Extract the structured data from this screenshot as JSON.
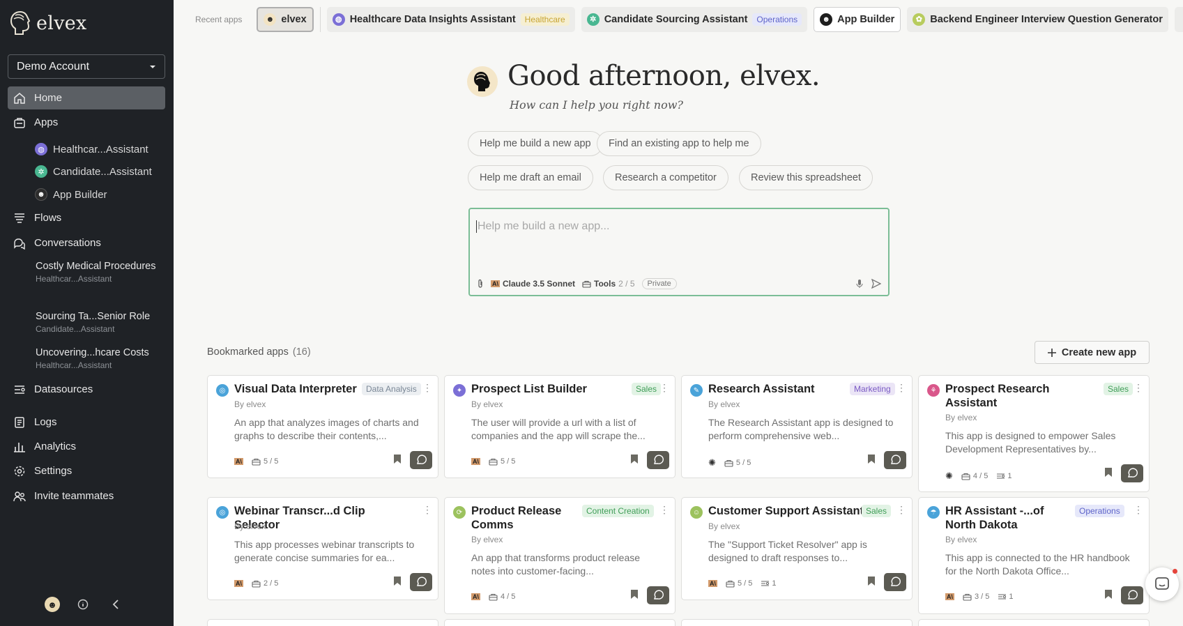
{
  "brand": {
    "name": "elvex"
  },
  "account": {
    "name": "Demo Account"
  },
  "sidebar": {
    "nav": [
      {
        "label": "Home"
      },
      {
        "label": "Apps"
      },
      {
        "label": "Flows"
      },
      {
        "label": "Conversations"
      },
      {
        "label": "Datasources"
      },
      {
        "label": "Logs"
      },
      {
        "label": "Analytics"
      },
      {
        "label": "Settings"
      },
      {
        "label": "Invite teammates"
      }
    ],
    "apps": [
      {
        "label": "Healthcar...Assistant"
      },
      {
        "label": "Candidate...Assistant"
      },
      {
        "label": "App Builder"
      }
    ],
    "conversations": [
      {
        "title": "Costly Medical Procedures",
        "app": "Healthcar...Assistant"
      },
      {
        "title": "Sourcing Ta...Senior Role",
        "app": "Candidate...Assistant"
      },
      {
        "title": "Uncovering...hcare Costs",
        "app": "Healthcar...Assistant"
      }
    ]
  },
  "topbar": {
    "label": "Recent apps",
    "chips": [
      {
        "name": "elvex",
        "tag": ""
      },
      {
        "name": "Healthcare Data Insights Assistant",
        "tag": "Healthcare"
      },
      {
        "name": "Candidate Sourcing Assistant",
        "tag": "Operations"
      },
      {
        "name": "App Builder",
        "tag": ""
      },
      {
        "name": "Backend Engineer Interview Question Generator",
        "tag": ""
      }
    ]
  },
  "hero": {
    "greeting": "Good afternoon, elvex.",
    "subtitle": "How can I help you right now?"
  },
  "suggestions": [
    "Help me build a new app",
    "Find an existing app to help me",
    "Help me draft an email",
    "Research a competitor",
    "Review this spreadsheet"
  ],
  "composer": {
    "placeholder": "Help me build a new app...",
    "model": "Claude 3.5 Sonnet",
    "tools_label": "Tools",
    "tools_count": "2 / 5",
    "visibility": "Private"
  },
  "bookmarks": {
    "title": "Bookmarked apps",
    "count": "(16)",
    "create_label": "Create new app"
  },
  "colors": {
    "sidebar_bg": "#1f2226",
    "accent_green": "#7bbd96",
    "healthcare_tag": "#f6efd2",
    "operations_tag": "#e6e8fa",
    "sales_tag": "#e2f3e5",
    "marketing_tag": "#ebe5f6"
  },
  "cards": [
    {
      "title": "Visual Data Interpreter",
      "tag": "Data Analysis",
      "by": "By elvex",
      "desc": "An app that analyzes images of charts and graphs to describe their contents,...",
      "tools": "5 / 5",
      "extra": ""
    },
    {
      "title": "Prospect List Builder",
      "tag": "Sales",
      "by": "By elvex",
      "desc": "The user will provide a url with a list of companies and the app will scrape the...",
      "tools": "5 / 5",
      "extra": ""
    },
    {
      "title": "Research Assistant",
      "tag": "Marketing",
      "by": "By elvex",
      "desc": "The Research Assistant app is designed to perform comprehensive web...",
      "tools": "5 / 5",
      "extra": ""
    },
    {
      "title": "Prospect Research Assistant",
      "tag": "Sales",
      "by": "By elvex",
      "desc": "This app is designed to empower Sales Development Representatives by...",
      "tools": "4 / 5",
      "extra": "1"
    },
    {
      "title": "Webinar Transcr...d Clip Selector",
      "tag": "",
      "by": "By elvex",
      "desc": "This app processes webinar transcripts to generate concise summaries for ea...",
      "tools": "2 / 5",
      "extra": ""
    },
    {
      "title": "Product Release Comms",
      "tag": "Content Creation",
      "by": "By elvex",
      "desc": "An app that transforms product release notes into customer-facing...",
      "tools": "4 / 5",
      "extra": ""
    },
    {
      "title": "Customer Support Assistant",
      "tag": "Sales",
      "by": "By elvex",
      "desc": "The \"Support Ticket Resolver\" app is designed to draft responses to...",
      "tools": "5 / 5",
      "extra": "1"
    },
    {
      "title": "HR Assistant -...of North Dakota",
      "tag": "Operations",
      "by": "By elvex",
      "desc": "This app is connected to the HR handbook for the North Dakota Office...",
      "tools": "3 / 5",
      "extra": "1"
    }
  ]
}
